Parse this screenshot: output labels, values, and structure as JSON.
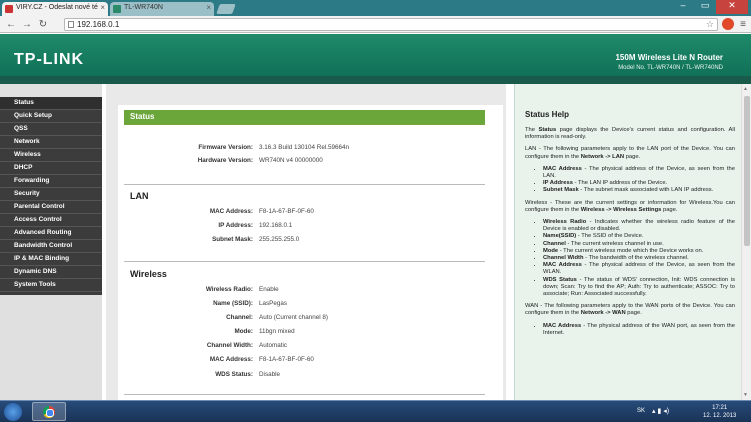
{
  "browser": {
    "tabs": [
      {
        "title": "VIRY.CZ - Odeslat nové té",
        "active": true
      },
      {
        "title": "TL-WR740N",
        "active": false
      }
    ],
    "address": "192.168.0.1"
  },
  "router": {
    "logo": "TP-LINK",
    "model_title": "150M Wireless Lite N Router",
    "model_sub": "Model No. TL-WR740N / TL-WR740ND"
  },
  "sidebar": {
    "items": [
      {
        "label": "Status"
      },
      {
        "label": "Quick Setup"
      },
      {
        "label": "QSS"
      },
      {
        "label": "Network"
      },
      {
        "label": "Wireless"
      },
      {
        "label": "DHCP"
      },
      {
        "label": "Forwarding"
      },
      {
        "label": "Security"
      },
      {
        "label": "Parental Control"
      },
      {
        "label": "Access Control"
      },
      {
        "label": "Advanced Routing"
      },
      {
        "label": "Bandwidth Control"
      },
      {
        "label": "IP & MAC Binding"
      },
      {
        "label": "Dynamic DNS"
      },
      {
        "label": "System Tools"
      }
    ]
  },
  "status": {
    "title": "Status",
    "firmware_label": "Firmware Version:",
    "firmware_value": "3.16.3 Build 130104 Rel.59664n",
    "hardware_label": "Hardware Version:",
    "hardware_value": "WR740N v4 00000000",
    "lan": {
      "title": "LAN",
      "mac_label": "MAC Address:",
      "mac_value": "F8-1A-67-BF-0F-60",
      "ip_label": "IP Address:",
      "ip_value": "192.168.0.1",
      "mask_label": "Subnet Mask:",
      "mask_value": "255.255.255.0"
    },
    "wireless": {
      "title": "Wireless",
      "radio_label": "Wireless Radio:",
      "radio_value": "Enable",
      "ssid_label": "Name (SSID):",
      "ssid_value": "LasPegas",
      "channel_label": "Channel:",
      "channel_value": "Auto (Current channel 8)",
      "mode_label": "Mode:",
      "mode_value": "11bgn mixed",
      "width_label": "Channel Width:",
      "width_value": "Automatic",
      "mac_label": "MAC Address:",
      "mac_value": "F8-1A-67-BF-0F-60",
      "wds_label": "WDS Status:",
      "wds_value": "Disable"
    }
  },
  "help": {
    "title": "Status Help",
    "intro_pre": "The ",
    "intro_bold": "Status",
    "intro_post": " page displays the Device's current status and configuration. All information is read-only.",
    "lan_intro": "LAN - The following parameters apply to the LAN port of the Device. You can configure them in the ",
    "lan_link": "Network -> LAN",
    "lan_end": " page.",
    "lan_items": [
      {
        "bold": "MAC Address",
        "text": " - The physical address of the Device, as seen from the LAN."
      },
      {
        "bold": "IP Address",
        "text": " - The LAN IP address of the Device."
      },
      {
        "bold": "Subnet Mask",
        "text": " - The subnet mask associated with LAN IP address."
      }
    ],
    "wl_intro": "Wireless - These are the current settings or information for Wireless.You can configure them in the ",
    "wl_link": "Wireless -> Wireless Settings",
    "wl_end": " page.",
    "wl_items": [
      {
        "bold": "Wireless Radio",
        "text": " - Indicates whether the wireless radio feature of the Device is enabled or disabled."
      },
      {
        "bold": "Name(SSID)",
        "text": " - The SSID of the Device."
      },
      {
        "bold": "Channel",
        "text": " - The current wireless channel in use."
      },
      {
        "bold": "Mode",
        "text": " - The current wireless mode which the Device works on."
      },
      {
        "bold": "Channel Width",
        "text": " - The bandwidth of the wireless channel."
      },
      {
        "bold": "MAC Address",
        "text": " - The physical address of the Device, as seen from the WLAN."
      },
      {
        "bold": "WDS Status",
        "text": " - The status of WDS' connection, Init: WDS connection is down; Scan: Try to find the AP; Auth: Try to authenticate; ASSOC: Try to associate; Run: Associated successfully."
      }
    ],
    "wan_intro": "WAN - The following parameters apply to the WAN ports of the Device. You can configure them in the ",
    "wan_link": "Network -> WAN",
    "wan_end": " page.",
    "wan_items": [
      {
        "bold": "MAC Address",
        "text": " - The physical address of the WAN port, as seen from the Internet."
      }
    ]
  },
  "taskbar": {
    "lang": "SK",
    "time": "17:21",
    "date": "12. 12. 2013"
  },
  "colors": {
    "header": "#0d6c54",
    "status_bar": "#6aa63a",
    "sidebar": "#3c3c3c",
    "help_bg": "#e9f3ec"
  }
}
